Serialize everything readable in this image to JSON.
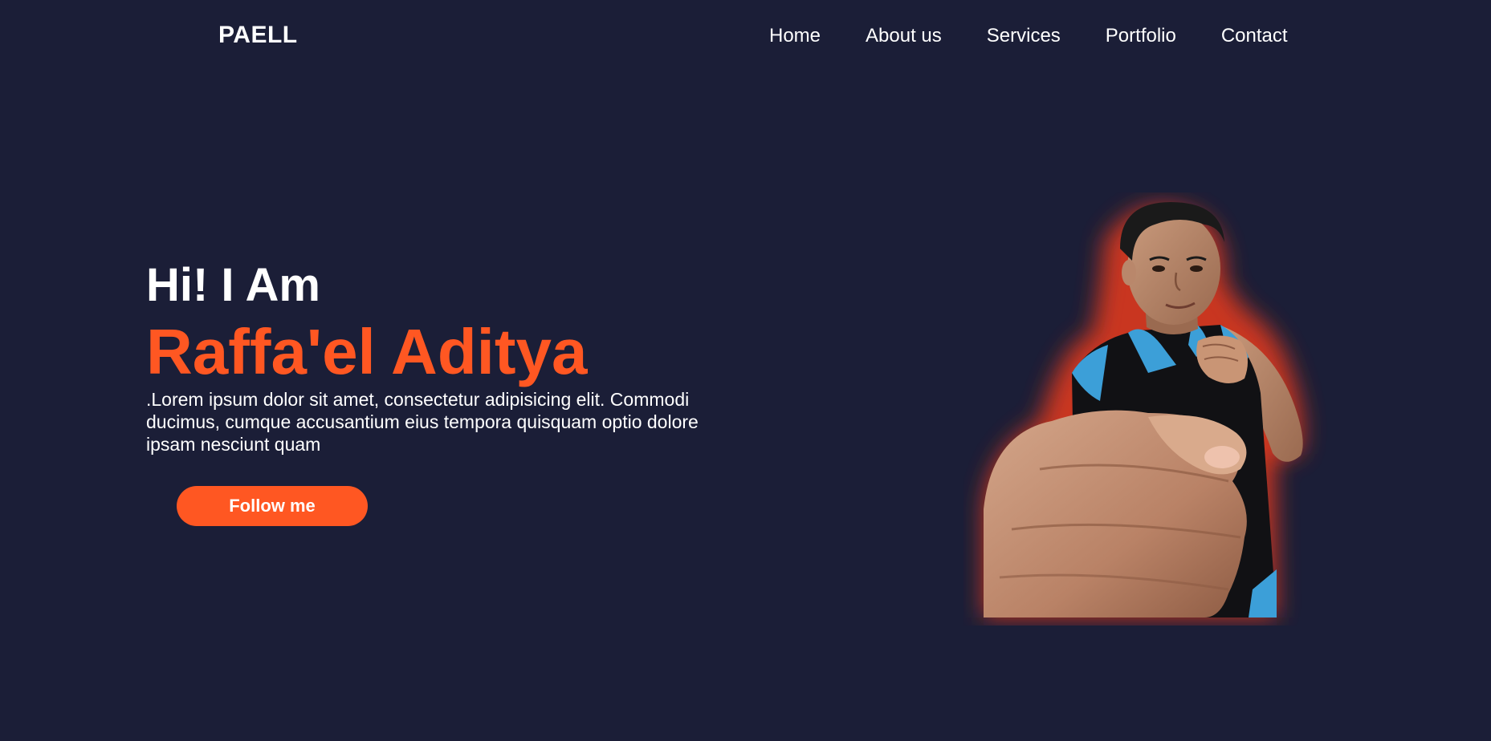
{
  "header": {
    "logo": "PAELL",
    "nav": [
      {
        "label": "Home"
      },
      {
        "label": "About us"
      },
      {
        "label": "Services"
      },
      {
        "label": "Portfolio"
      },
      {
        "label": "Contact"
      }
    ]
  },
  "hero": {
    "greeting": "Hi! I Am",
    "name": "Raffa'el Aditya",
    "description": ".Lorem ipsum dolor sit amet, consectetur adipisicing elit. Commodi ducimus, cumque accusantium eius tempora quisquam optio dolore ipsam nesciunt quam",
    "button_label": "Follow me",
    "image_icon": "person-portrait-image"
  },
  "colors": {
    "background": "#1b1e37",
    "accent": "#ff5722",
    "text": "#ffffff",
    "shirt_blue": "#3c9fd8",
    "shirt_black": "#111114"
  }
}
